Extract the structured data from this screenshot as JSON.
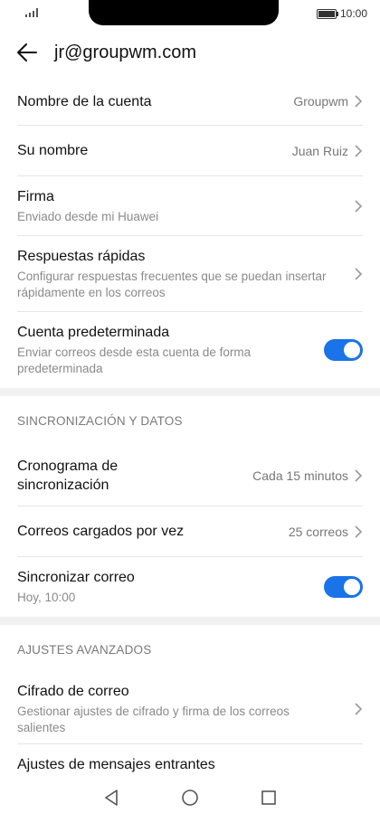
{
  "status": {
    "time": "10:00"
  },
  "header": {
    "title": "jr@groupwm.com"
  },
  "rows": {
    "account_name": {
      "label": "Nombre de la cuenta",
      "value": "Groupwm"
    },
    "your_name": {
      "label": "Su nombre",
      "value": "Juan Ruiz"
    },
    "signature": {
      "label": "Firma",
      "sub": "Enviado desde mi Huawei"
    },
    "quick_replies": {
      "label": "Respuestas rápidas",
      "sub": "Configurar respuestas frecuentes que se puedan insertar rápidamente en los correos"
    },
    "default_account": {
      "label": "Cuenta predeterminada",
      "sub": "Enviar correos desde esta cuenta de forma predeterminada",
      "enabled": true
    }
  },
  "sync_section": {
    "title": "SINCRONIZACIÓN Y DATOS",
    "schedule": {
      "label": "Cronograma de sincronización",
      "value": "Cada 15 minutos"
    },
    "per_load": {
      "label": "Correos cargados por vez",
      "value": "25 correos"
    },
    "sync_mail": {
      "label": "Sincronizar correo",
      "sub": "Hoy, 10:00",
      "enabled": true
    }
  },
  "advanced_section": {
    "title": "AJUSTES AVANZADOS",
    "encryption": {
      "label": "Cifrado de correo",
      "sub": "Gestionar ajustes de cifrado y firma de los correos salientes"
    },
    "incoming": {
      "label": "Ajustes de mensajes entrantes"
    }
  },
  "icons": {
    "back": "arrow-left-icon",
    "chevron": "chevron-right-icon",
    "nav": [
      "back-triangle-icon",
      "home-circle-icon",
      "recents-square-icon"
    ]
  },
  "colors": {
    "accent": "#1a73e8",
    "separator": "#f1f1f1"
  }
}
